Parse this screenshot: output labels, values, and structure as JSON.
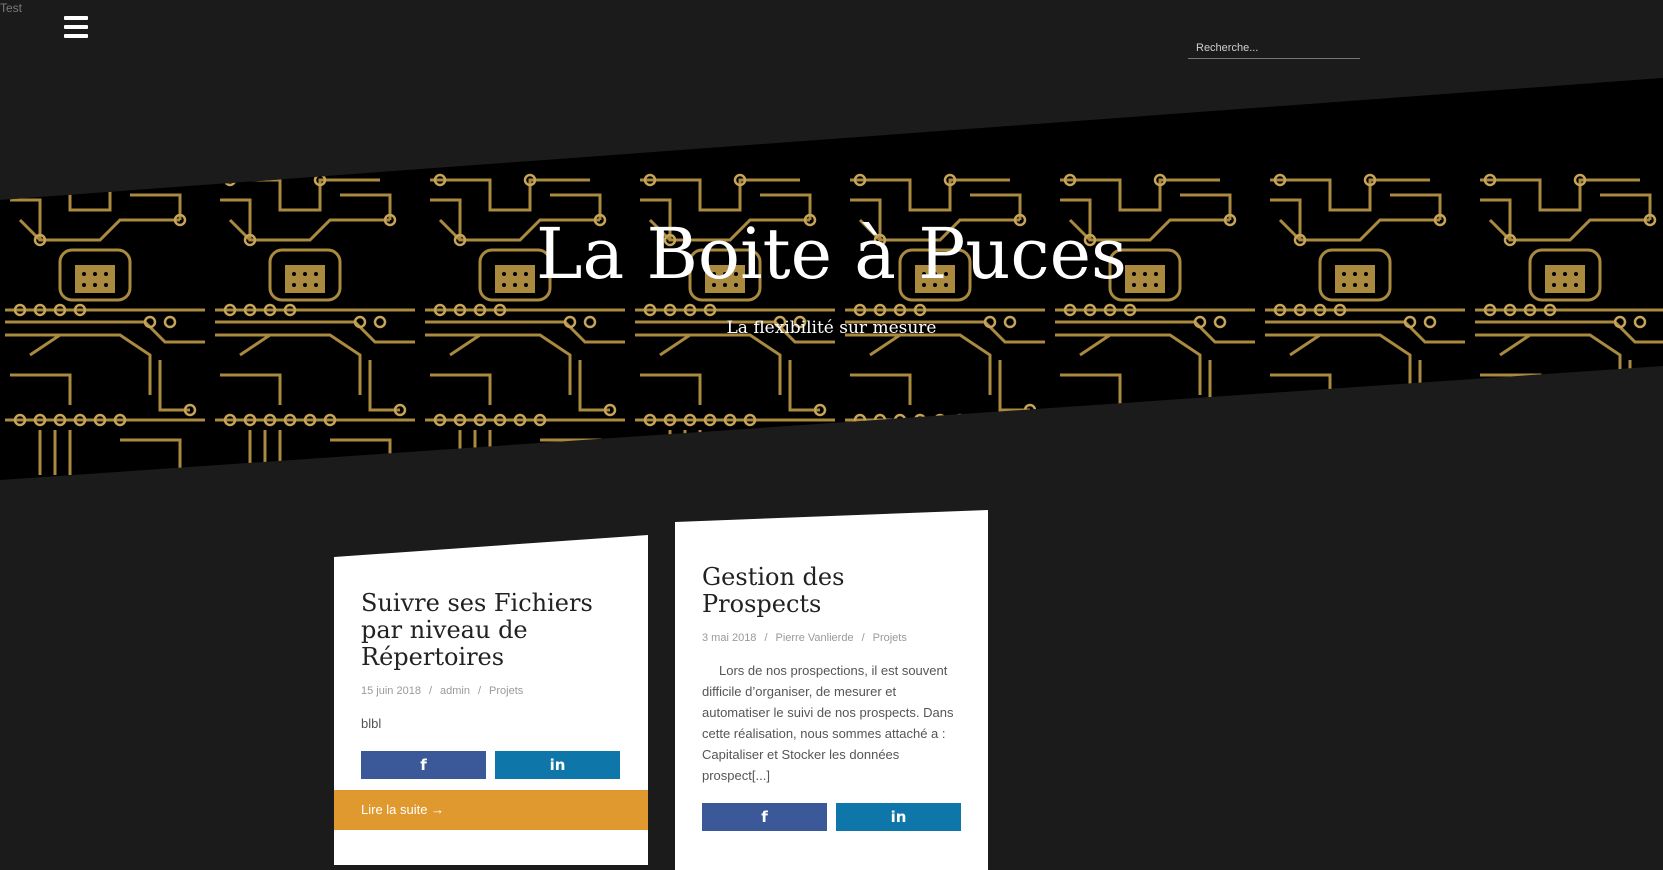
{
  "top_label": "Test",
  "search": {
    "placeholder": "Recherche..."
  },
  "hero": {
    "title": "La Boite à Puces",
    "subtitle": "La flexibilité sur mesure"
  },
  "icons": {
    "menu": "hamburger-menu-icon",
    "facebook": "facebook-icon",
    "linkedin": "linkedin-icon"
  },
  "colors": {
    "background": "#1b1b1b",
    "accent": "#e0992f",
    "circuit_gold": "#a98a3f",
    "facebook": "#3b5998",
    "linkedin": "#0e76a8"
  },
  "posts": [
    {
      "title": "Suivre ses Fichiers par niveau de Répertoires",
      "date": "15 juin 2018",
      "author": "admin",
      "category": "Projets",
      "excerpt": "blbl",
      "read_more": "Lire la suite →"
    },
    {
      "title": "Gestion des Prospects",
      "date": "3 mai 2018",
      "author": "Pierre Vanlierde",
      "category": "Projets",
      "excerpt": "Lors de nos prospections, il est souvent difficile d’organiser, de mesurer et automatiser le suivi de nos prospects. Dans cette réalisation, nous sommes attaché a : Capitaliser et Stocker les données prospect",
      "more_link": "[...]"
    }
  ],
  "share": {
    "fb_glyph": "f",
    "li_glyph": "in"
  },
  "meta_separator": "/"
}
